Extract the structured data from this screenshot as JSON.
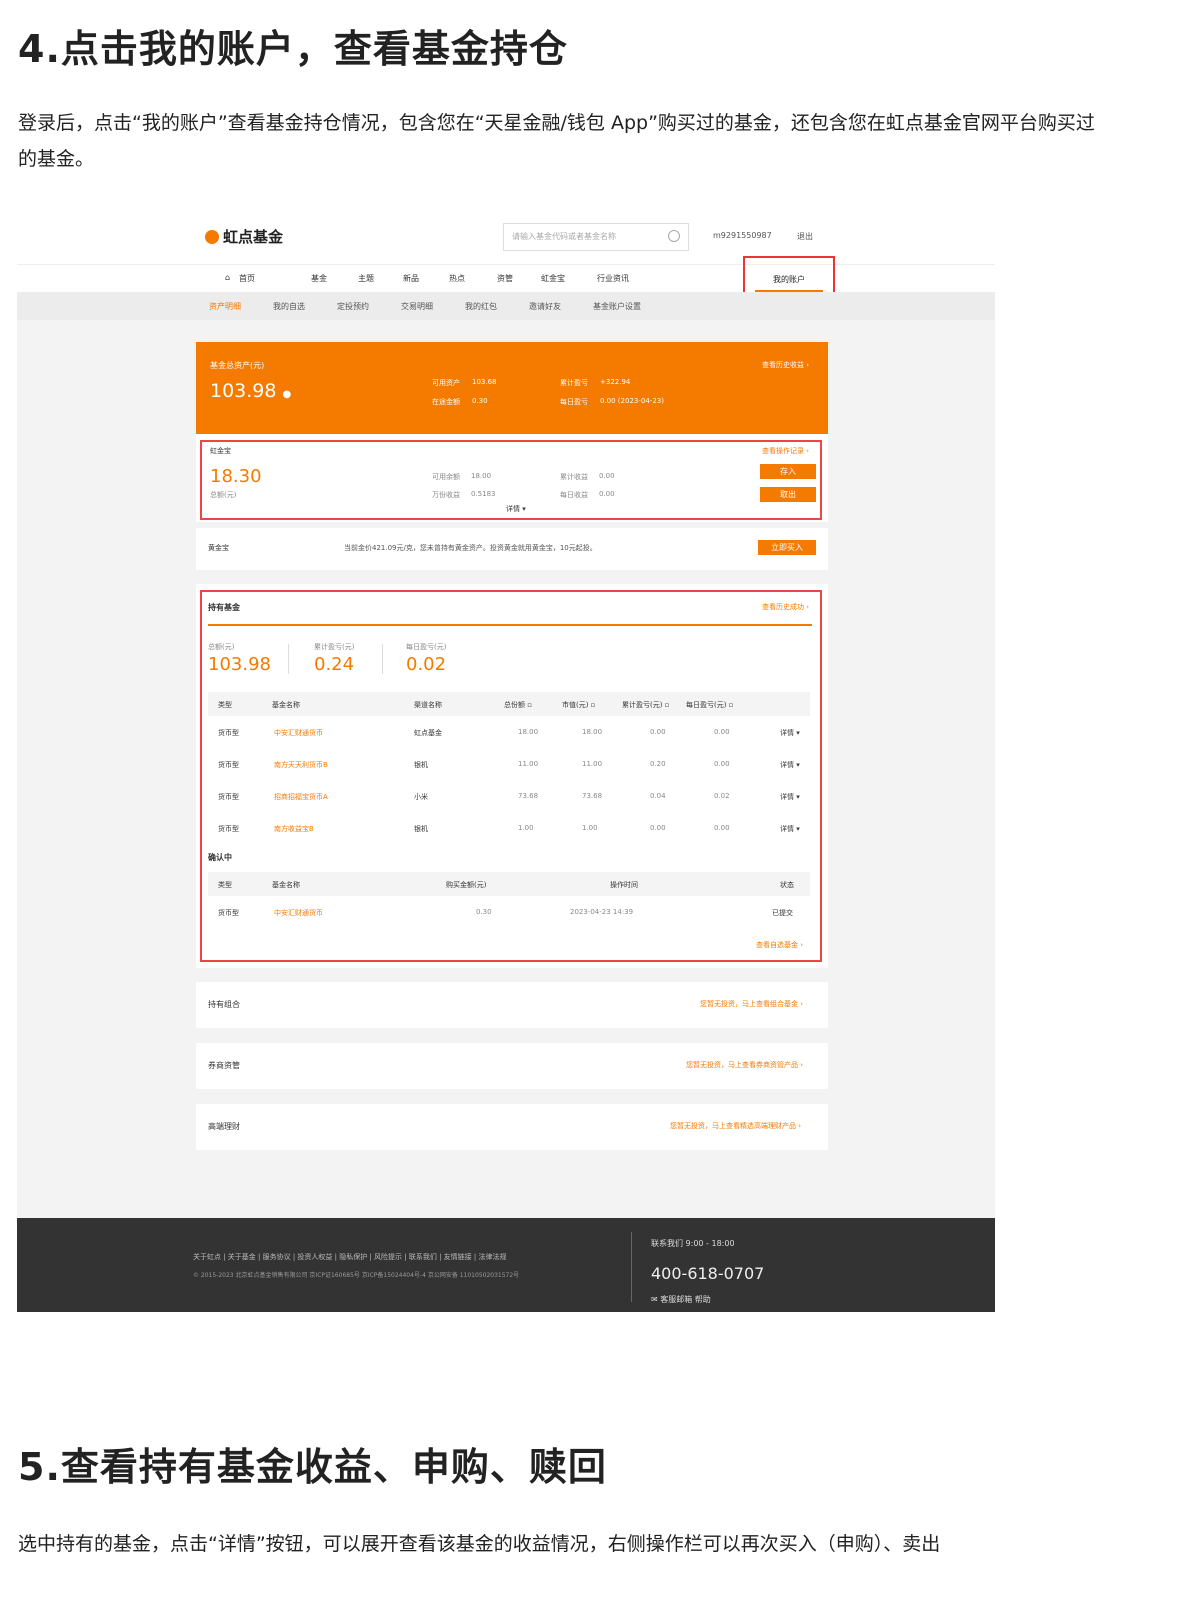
{
  "doc": {
    "heading4": "4.点击我的账户，查看基金持仓",
    "para4_line1": "登录后，点击“我的账户”查看基金持仓情况，包含您在“天星金融/钱包 App”购买过的基金，还包含您在虹点基金官网平台购买过",
    "para4_line2": "的基金。",
    "heading5": "5.查看持有基金收益、申购、赎回",
    "para5": "选中持有的基金，点击“详情”按钮，可以展开查看该基金的收益情况，右侧操作栏可以再次买入（申购）、卖出"
  },
  "site": {
    "logo": "虹点基金",
    "search_placeholder": "请输入基金代码或者基金名称",
    "user": "m9291550987",
    "logout": "退出",
    "nav": [
      "首页",
      "基金",
      "主题",
      "新品",
      "热点",
      "资管",
      "虹金宝",
      "行业资讯"
    ],
    "my_account": "我的账户",
    "subnav": [
      "资产明细",
      "我的自选",
      "定投预约",
      "交易明细",
      "我的红包",
      "邀请好友",
      "基金账户设置"
    ]
  },
  "summary": {
    "label": "基金总资产(元)",
    "total": "103.98",
    "available_label": "可用资产",
    "available": "103.68",
    "transit_label": "在途金额",
    "transit": "0.30",
    "cum_label": "累计盈亏",
    "cum": "+322.94",
    "daily_label": "每日盈亏",
    "daily": "0.00 (2023-04-23)",
    "history_link": "查看历史收益 ›"
  },
  "hongjinbao": {
    "name": "虹金宝",
    "amount": "18.30",
    "amount_label": "总额(元)",
    "avail_label": "可用余额",
    "avail": "18.00",
    "wan_label": "万份收益",
    "wan": "0.5183",
    "cum_label": "累计收益",
    "cum": "0.00",
    "daily_label": "每日收益",
    "daily": "0.00",
    "detail": "详情 ▾",
    "record_link": "查看操作记录 ›",
    "deposit": "存入",
    "withdraw": "取出"
  },
  "gold": {
    "name": "黄金宝",
    "desc": "当前金价421.09元/克，您未曾持有黄金资产。投资黄金就用黄金宝，10元起投。",
    "buy": "立即买入"
  },
  "holdings": {
    "title": "持有基金",
    "link": "查看历史成功 ›",
    "total_label": "总额(元)",
    "total": "103.98",
    "cum_label": "累计盈亏(元)",
    "cum": "0.24",
    "daily_label": "每日盈亏(元)",
    "daily": "0.02",
    "headers": [
      "类型",
      "基金名称",
      "渠道名称",
      "总份额 ▫",
      "市值(元) ▫",
      "累计盈亏(元) ▫",
      "每日盈亏(元) ▫"
    ],
    "rows": [
      {
        "type": "货币型",
        "name": "中安汇财通货币",
        "channel": "虹点基金",
        "shares": "18.00",
        "value": "18.00",
        "cum": "0.00",
        "daily": "0.00",
        "detail": "详情 ▾"
      },
      {
        "type": "货币型",
        "name": "南方天天利货币B",
        "channel": "银机",
        "shares": "11.00",
        "value": "11.00",
        "cum": "0.20",
        "daily": "0.00",
        "detail": "详情 ▾"
      },
      {
        "type": "货币型",
        "name": "招商招福宝货币A",
        "channel": "小米",
        "shares": "73.68",
        "value": "73.68",
        "cum": "0.04",
        "daily": "0.02",
        "detail": "详情 ▾"
      },
      {
        "type": "货币型",
        "name": "南方收益宝B",
        "channel": "银机",
        "shares": "1.00",
        "value": "1.00",
        "cum": "0.00",
        "daily": "0.00",
        "detail": "详情 ▾"
      }
    ],
    "confirming_title": "确认中",
    "c_headers": [
      "类型",
      "基金名称",
      "购买金额(元)",
      "操作时间",
      "状态"
    ],
    "c_row": {
      "type": "货币型",
      "name": "中安汇财通货币",
      "amount": "0.30",
      "time": "2023-04-23 14:39",
      "status": "已提交"
    },
    "bottom_link": "查看自选基金 ›"
  },
  "sections": [
    {
      "title": "持有组合",
      "link": "您暂无投资，马上查看组合基金 ›"
    },
    {
      "title": "券商资管",
      "link": "您暂无投资，马上查看券商资管产品 ›"
    },
    {
      "title": "高端理财",
      "link": "您暂无投资，马上查看精选高端理财产品 ›"
    }
  ],
  "footer": {
    "links": "关于虹点 | 关于基金 | 服务协议 | 投资人权益 | 隐私保护 | 风险提示 | 联系我们 | 友情链接 | 法律法规",
    "copy": "© 2015-2023 北京虹点基金销售有限公司 京ICP证160685号 京ICP备15024404号-4 京公网安备 11010502031572号",
    "contact": "联系我们 9:00 - 18:00",
    "phone": "400-618-0707",
    "help": "客服邮箱   帮助"
  }
}
